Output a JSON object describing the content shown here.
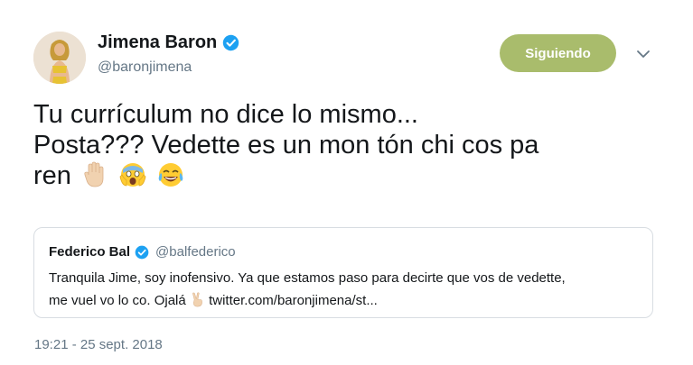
{
  "author": {
    "name": "Jimena Baron",
    "handle": "@baronjimena",
    "verified": true
  },
  "follow_button": {
    "label": "Siguiendo",
    "color": "#a9bc6c"
  },
  "menu": {
    "icon": "chevron-down-icon"
  },
  "tweet": {
    "line1": "Tu currículum no dice lo mismo...",
    "line2": "Posta??? Vedette es un mon tón chi cos pa",
    "line3": "ren",
    "emojis": [
      "raised-hand-emoji",
      "screaming-face-emoji",
      "tears-of-joy-emoji"
    ]
  },
  "quoted_tweet": {
    "name": "Federico Bal",
    "handle": "@balfederico",
    "verified": true,
    "line1": "Tranquila Jime, soy inofensivo. Ya que estamos paso para decirte que vos de vedette,",
    "line2_before": "me vuel vo lo co. Ojalá",
    "line2_link": "twitter.com/baronjimena/st..."
  },
  "timestamp": "19:21 - 25 sept. 2018",
  "colors": {
    "verified": "#1da1f2",
    "secondary_text": "#657786",
    "border": "#d8dde2"
  }
}
